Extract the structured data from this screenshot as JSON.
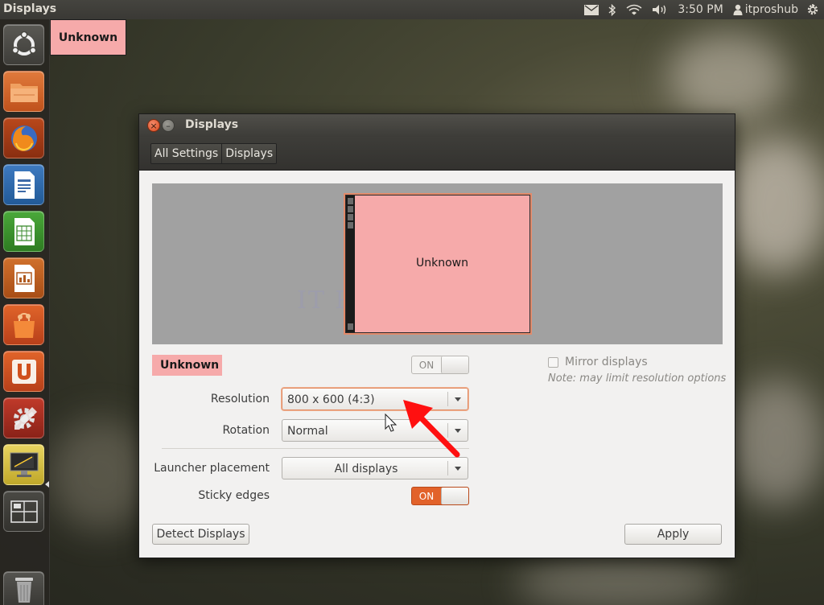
{
  "top_panel": {
    "title": "Displays",
    "indicators": {
      "mail_icon": "envelope-icon",
      "bluetooth_icon": "bluetooth-icon",
      "network_icon": "wifi-icon",
      "sound_icon": "volume-icon",
      "time": "3:50 PM",
      "user": "itproshub",
      "session_icon": "power-gear-icon"
    }
  },
  "launcher": {
    "items": [
      {
        "name": "ubuntu-dash",
        "icon": "ubuntu-logo-icon"
      },
      {
        "name": "home-folder",
        "icon": "folder-icon"
      },
      {
        "name": "firefox",
        "icon": "firefox-icon"
      },
      {
        "name": "libreoffice-writer",
        "icon": "writer-icon"
      },
      {
        "name": "libreoffice-calc",
        "icon": "calc-icon"
      },
      {
        "name": "libreoffice-impress",
        "icon": "impress-icon"
      },
      {
        "name": "ubuntu-software-center",
        "icon": "shopping-bag-icon"
      },
      {
        "name": "ubuntu-one",
        "icon": "ubuntu-one-icon"
      },
      {
        "name": "system-settings",
        "icon": "settings-wrench-icon"
      },
      {
        "name": "displays",
        "icon": "display-icon"
      },
      {
        "name": "workspace-switcher",
        "icon": "workspaces-icon"
      },
      {
        "name": "trash",
        "icon": "trash-icon"
      }
    ]
  },
  "desktop_label": "Unknown",
  "window": {
    "title": "Displays",
    "breadcrumbs": [
      "All Settings",
      "Displays"
    ],
    "preview": {
      "monitor_label": "Unknown",
      "watermark": "IT Pros HUB"
    },
    "monitor_name": "Unknown",
    "monitor_switch": "ON",
    "mirror_displays": "Mirror displays",
    "mirror_note": "Note: may limit resolution options",
    "resolution": {
      "label": "Resolution",
      "value": "800 x 600 (4:3)"
    },
    "rotation": {
      "label": "Rotation",
      "value": "Normal"
    },
    "launcher_placement": {
      "label": "Launcher placement",
      "value": "All displays"
    },
    "sticky_edges": {
      "label": "Sticky edges",
      "value": "ON"
    },
    "detect_button": "Detect Displays",
    "apply_button": "Apply"
  },
  "colors": {
    "accent": "#e2622a",
    "monitor_fill": "#f6aaaa",
    "annotation_arrow": "#ff1010"
  }
}
